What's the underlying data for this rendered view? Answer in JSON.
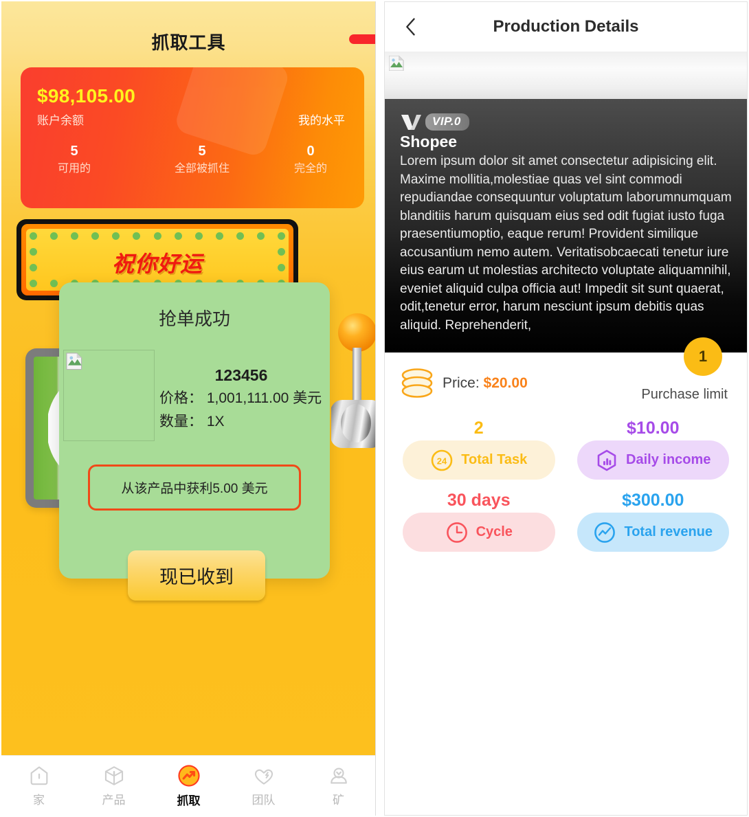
{
  "left": {
    "title": "抓取工具",
    "balance": {
      "amount": "$98,105.00",
      "amount_label": "账户余额",
      "level_label": "我的水平",
      "stats": [
        {
          "value": "5",
          "label": "可用的"
        },
        {
          "value": "5",
          "label": "全部被抓住"
        },
        {
          "value": "0",
          "label": "完全的"
        }
      ]
    },
    "marquee_text": "祝你好运",
    "modal": {
      "title": "抢单成功",
      "sku": "123456",
      "price_line": "价格： 1,001,111.00 美元",
      "qty_line": "数量： 1X",
      "profit_text": "从该产品中获利5.00 美元",
      "button_label": "现已收到"
    },
    "nav": [
      {
        "label": "家",
        "icon": "home-icon",
        "active": false
      },
      {
        "label": "产品",
        "icon": "cube-icon",
        "active": false
      },
      {
        "label": "抓取",
        "icon": "grab-trend-icon",
        "active": true
      },
      {
        "label": "团队",
        "icon": "team-heart-icon",
        "active": false
      },
      {
        "label": "矿",
        "icon": "mine-icon",
        "active": false
      }
    ]
  },
  "right": {
    "header": {
      "title": "Production Details",
      "back_icon": "back-chevron-icon"
    },
    "vip_tag": "VIP.0",
    "brand": "Shopee",
    "description": "Lorem ipsum dolor sit amet consectetur adipisicing elit. Maxime mollitia,molestiae quas vel sint commodi repudiandae consequuntur voluptatum laborumnumquam blanditiis harum quisquam eius sed odit fugiat iusto fuga praesentiumoptio, eaque rerum! Provident similique accusantium nemo autem. Veritatisobcaecati tenetur iure eius earum ut molestias architecto voluptate aliquamnihil, eveniet aliquid culpa officia aut! Impedit sit sunt quaerat, odit,tenetur error, harum nesciunt ipsum debitis quas aliquid. Reprehenderit,",
    "price_prefix": "Price: ",
    "price_value": "$20.00",
    "purchase_limit_label": "Purchase limit",
    "purchase_limit_value": "1",
    "stats": [
      {
        "value": "2",
        "label": "Total Task",
        "icon": "task-24-icon",
        "color": "#FBBC15"
      },
      {
        "value": "$10.00",
        "label": "Daily income",
        "icon": "bar-chart-icon",
        "color": "#A64BE8"
      },
      {
        "value": "30 days",
        "label": "Cycle",
        "icon": "clock-icon",
        "color": "#F9545C"
      },
      {
        "value": "$300.00",
        "label": "Total revenue",
        "icon": "line-chart-icon",
        "color": "#2AA3EE"
      }
    ]
  }
}
